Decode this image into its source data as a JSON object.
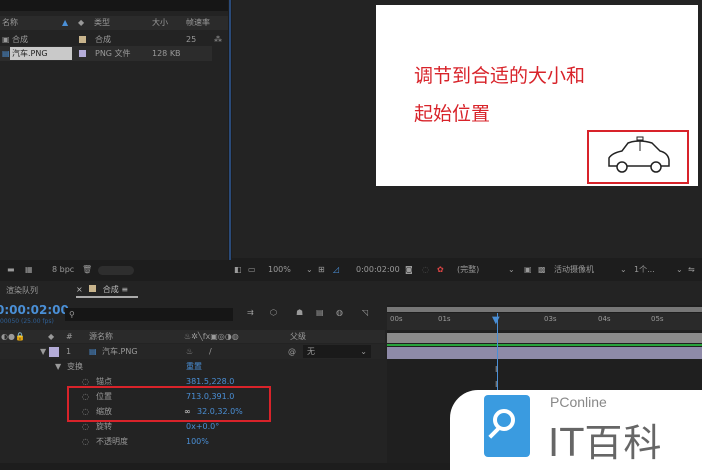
{
  "project": {
    "columns": {
      "name": "名称",
      "type": "类型",
      "size": "大小",
      "fps": "帧速率"
    },
    "items": [
      {
        "name": "合成",
        "type": "合成",
        "size": "",
        "fps": "25",
        "color": "#c8b48c"
      },
      {
        "name": "汽车.PNG",
        "type": "PNG 文件",
        "size": "128 KB",
        "fps": "",
        "color": "#b4acd8"
      }
    ],
    "bpc": "8 bpc"
  },
  "viewer": {
    "annotation_line1": "调节到合适的大小和",
    "annotation_line2": "起始位置",
    "zoom": "100%",
    "timecode": "0:00:02:00",
    "resolution": "(完整)",
    "camera": "活动摄像机",
    "views": "1个..."
  },
  "timeline": {
    "tabs": {
      "render_queue": "渲染队列",
      "comp": "合成"
    },
    "timecode": "0:00:02:00",
    "frame_info": "00050 (25.00 fps)",
    "columns": {
      "index": "#",
      "source": "源名称",
      "parent": "父级"
    },
    "layer": {
      "index": "1",
      "name": "汽车.PNG",
      "parent": "无"
    },
    "transform": {
      "label": "变换",
      "reset": "重置"
    },
    "properties": [
      {
        "name": "锚点",
        "value": "381.5,228.0"
      },
      {
        "name": "位置",
        "value": "713.0,391.0"
      },
      {
        "name": "缩放",
        "value": "32.0,32.0%"
      },
      {
        "name": "旋转",
        "value": "0x+0.0°"
      },
      {
        "name": "不透明度",
        "value": "100%"
      }
    ],
    "ruler": [
      "00s",
      "01s",
      "02s",
      "03s",
      "04s",
      "05s"
    ]
  },
  "watermark": {
    "brand": "PConline",
    "title": "IT百科"
  },
  "colors": {
    "accent": "#4a8fd6",
    "highlight": "#d8232a",
    "layer_bar": "#8e8aa8",
    "track": "#27a23a"
  }
}
